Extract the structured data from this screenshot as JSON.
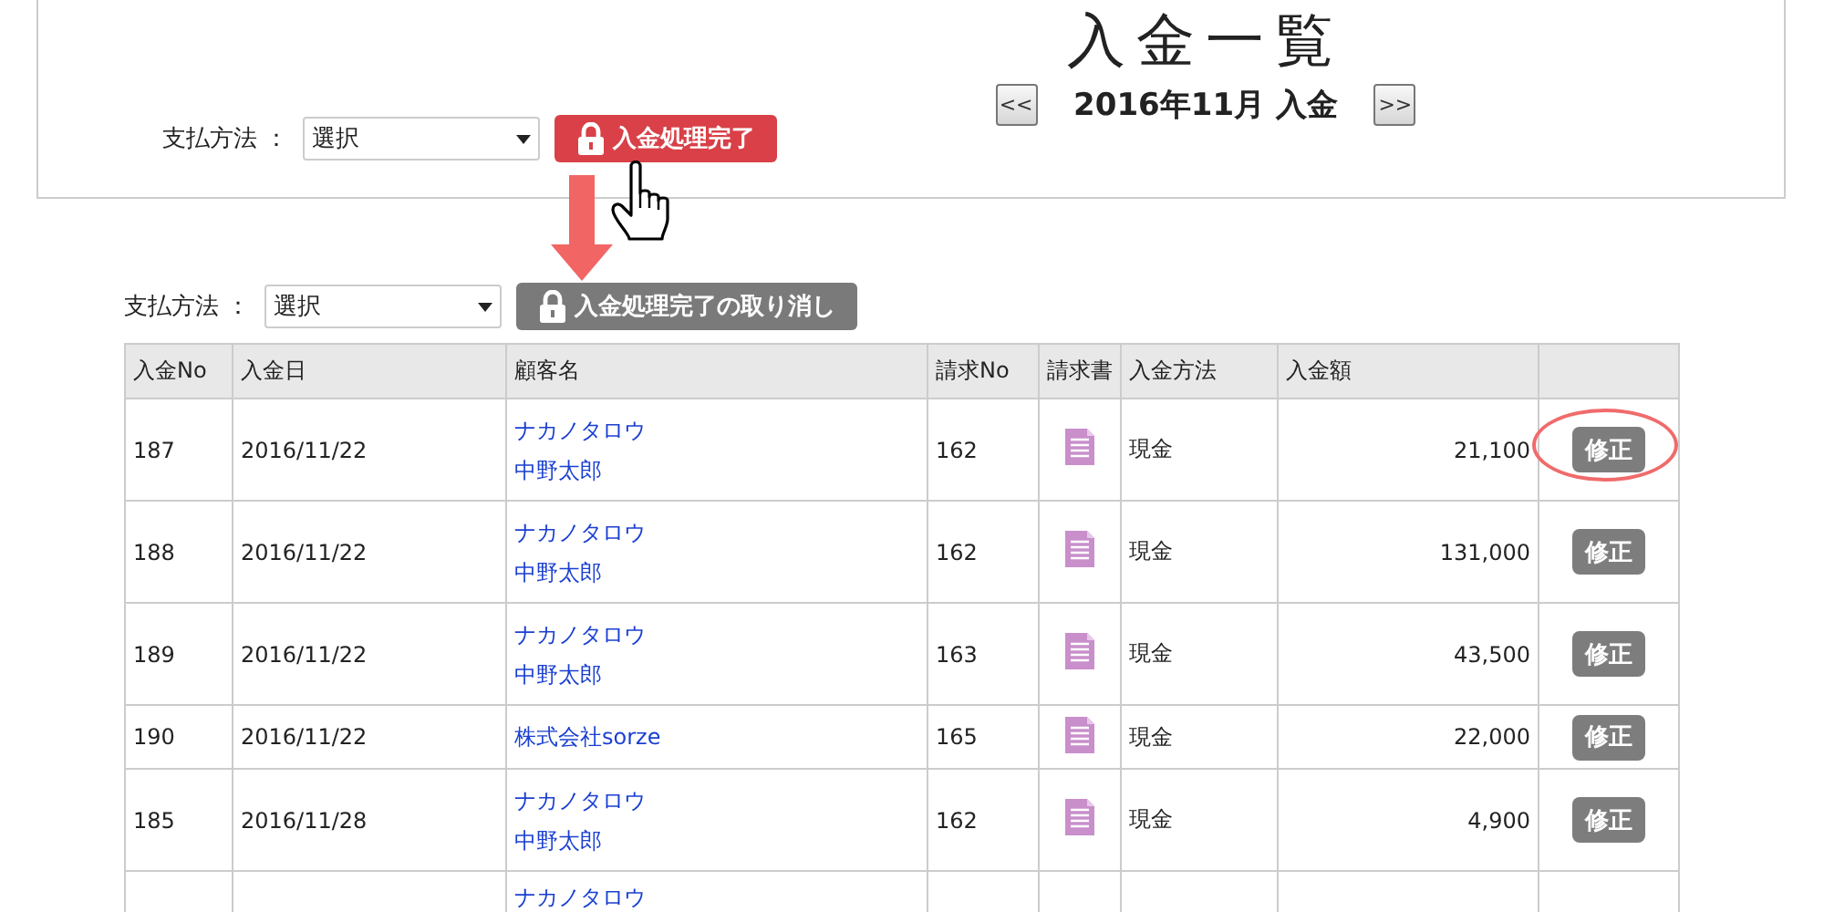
{
  "title": "入金一覧",
  "month_nav": {
    "prev": "<<",
    "label": "2016年11月 入金",
    "next": ">>"
  },
  "filter_top": {
    "label": "支払方法 ：",
    "select_value": "選択",
    "button": {
      "kind": "complete",
      "label": "入金処理完了"
    }
  },
  "filter_bottom": {
    "label": "支払方法 ：",
    "select_value": "選択",
    "button": {
      "kind": "cancel",
      "label": "入金処理完了の取り消し"
    }
  },
  "table": {
    "columns": [
      "入金No",
      "入金日",
      "顧客名",
      "請求No",
      "請求書",
      "入金方法",
      "入金額"
    ],
    "rows": [
      {
        "no": "187",
        "date": "2016/11/22",
        "customer": [
          "ナカノタロウ",
          "中野太郎"
        ],
        "invoice_no": "162",
        "method": "現金",
        "amount": "21,100",
        "action": "修正",
        "circled": true
      },
      {
        "no": "188",
        "date": "2016/11/22",
        "customer": [
          "ナカノタロウ",
          "中野太郎"
        ],
        "invoice_no": "162",
        "method": "現金",
        "amount": "131,000",
        "action": "修正",
        "circled": false
      },
      {
        "no": "189",
        "date": "2016/11/22",
        "customer": [
          "ナカノタロウ",
          "中野太郎"
        ],
        "invoice_no": "163",
        "method": "現金",
        "amount": "43,500",
        "action": "修正",
        "circled": false
      },
      {
        "no": "190",
        "date": "2016/11/22",
        "customer": [
          "株式会社sorze"
        ],
        "invoice_no": "165",
        "method": "現金",
        "amount": "22,000",
        "action": "修正",
        "circled": false
      },
      {
        "no": "185",
        "date": "2016/11/28",
        "customer": [
          "ナカノタロウ",
          "中野太郎"
        ],
        "invoice_no": "162",
        "method": "現金",
        "amount": "4,900",
        "action": "修正",
        "circled": false
      },
      {
        "customer": [
          "ナカノタロウ"
        ]
      }
    ]
  }
}
